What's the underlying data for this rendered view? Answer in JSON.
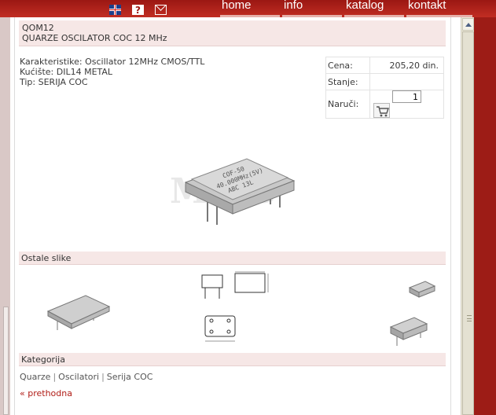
{
  "nav": {
    "home": "home",
    "info": "info",
    "katalog": "katalog",
    "kontakt": "kontakt"
  },
  "product": {
    "code": "QOM12",
    "name": "QUARZE OSCILATOR COC 12 MHz",
    "karakteristike": "Karakteristike: Oscillator 12MHz CMOS/TTL",
    "kuciste": "Kućište: DIL14 METAL",
    "tip": "Tip: SERIJA COC"
  },
  "price_table": {
    "cena_label": "Cena:",
    "cena_value": "205,20 din.",
    "stanje_label": "Stanje:",
    "stanje_value": "",
    "naruci_label": "Naruči:",
    "quantity": "1"
  },
  "main_image": {
    "chip_line1": "COF-50",
    "chip_line2": "40.000MHz(5V)",
    "chip_line3": "ABC 13L"
  },
  "sections": {
    "ostale_slike": "Ostale slike",
    "kategorija": "Kategorija"
  },
  "categories": [
    "Quarze",
    "Oscilatori",
    "Serija COC"
  ],
  "back_link": "« prethodna",
  "colors": {
    "brand_red": "#9b1713",
    "band_pink": "#f6e7e6",
    "link_red": "#b01c16"
  },
  "icons": [
    "uk-flag-icon",
    "help-icon",
    "mail-icon",
    "cart-icon"
  ]
}
